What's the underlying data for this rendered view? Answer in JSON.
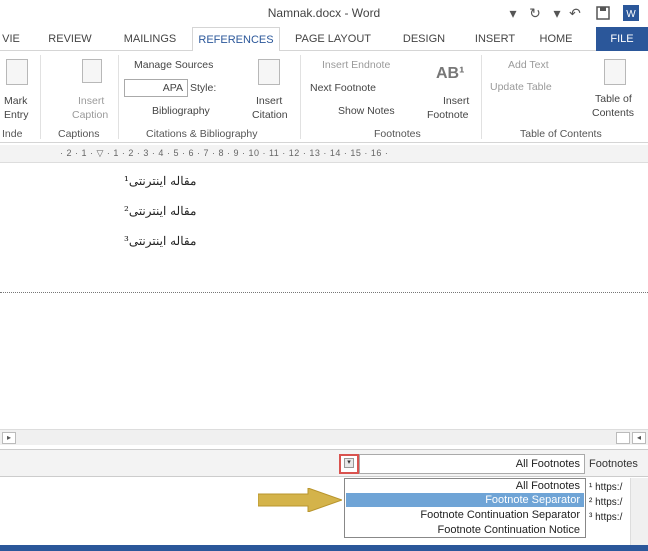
{
  "window": {
    "title": "Namnak.docx - Word"
  },
  "tabs": [
    {
      "key": "file",
      "label": "FILE"
    },
    {
      "key": "home",
      "label": "HOME"
    },
    {
      "key": "insert",
      "label": "INSERT"
    },
    {
      "key": "design",
      "label": "DESIGN"
    },
    {
      "key": "page_layout",
      "label": "PAGE LAYOUT"
    },
    {
      "key": "references",
      "label": "REFERENCES"
    },
    {
      "key": "mailings",
      "label": "MAILINGS"
    },
    {
      "key": "review",
      "label": "REVIEW"
    },
    {
      "key": "view",
      "label": "VIE"
    }
  ],
  "ribbon": {
    "toc": {
      "group": "Table of Contents",
      "table_of_contents": "Table of",
      "table_of_contents2": "Contents",
      "add_text": "Add Text",
      "update_table": "Update Table"
    },
    "footnotes": {
      "group": "Footnotes",
      "insert_footnote": "Insert",
      "insert_footnote2": "Footnote",
      "insert_endnote": "Insert Endnote",
      "next_footnote": "Next Footnote",
      "show_notes": "Show Notes"
    },
    "citations": {
      "group": "Citations & Bibliography",
      "insert_citation": "Insert",
      "insert_citation2": "Citation",
      "manage_sources": "Manage Sources",
      "style_label": "Style:",
      "style_value": "APA",
      "bibliography": "Bibliography"
    },
    "captions": {
      "group": "Captions",
      "insert_caption": "Insert",
      "insert_caption2": "Caption"
    },
    "index": {
      "group": "Inde",
      "mark_entry": "Mark",
      "mark_entry2": "Entry"
    }
  },
  "ruler": {
    "text": "· 2 · 1 · ▽ · 1 · 2 · 3 · 4 · 5 · 6 · 7 · 8 · 9 · 10 · 11 · 12 · 13 · 14 · 15 · 16 ·"
  },
  "document": {
    "lines": [
      "ﻣﻘﺎﻟﻪ ﺍﻳﻨﺘﺮﻧﺘﯽ¹",
      "ﻣﻘﺎﻟﻪ ﺍﻳﻨﺘﺮﻧﺘﯽ²",
      "ﻣﻘﺎﻟﻪ ﺍﻳﻨﺘﺮﻧﺘﯽ³"
    ]
  },
  "footnote_pane": {
    "label": "Footnotes",
    "selected": "All Footnotes",
    "options": [
      "All Footnotes",
      "Footnote Separator",
      "Footnote Continuation Separator",
      "Footnote Continuation Notice"
    ],
    "highlighted_index": 1,
    "entries": [
      "¹ https:/",
      "² https:/",
      "³ https:/"
    ]
  },
  "colors": {
    "accent": "#2b579a",
    "highlight": "#6fa4d6",
    "arrow": "#d4b34a",
    "dropdown_border": "#d9534f"
  }
}
